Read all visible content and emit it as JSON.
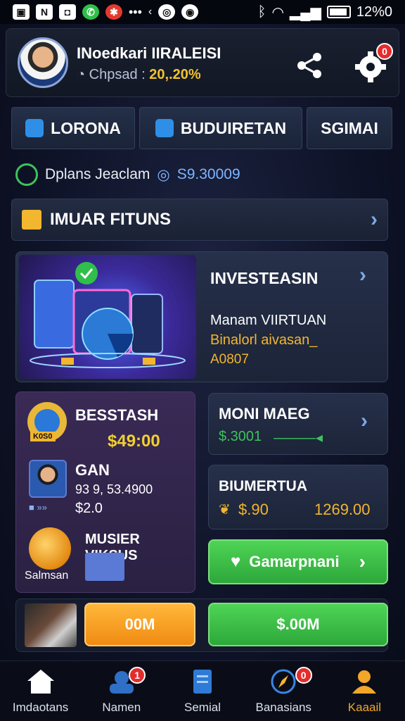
{
  "status_bar": {
    "time": "12%0"
  },
  "profile": {
    "name": "INoedkari IIRALEISI",
    "stat_label": "Chpsad :",
    "stat_value": "20,.20%",
    "settings_badge": "0"
  },
  "tabs": [
    {
      "label": "LORONA"
    },
    {
      "label": "BUDUIRETAN"
    },
    {
      "label": "SGIMAI"
    }
  ],
  "balance": {
    "label": "Dplans Jeaclam",
    "value": "S9.30009"
  },
  "banner": {
    "title": "IMUAR FITUNS"
  },
  "invest_card": {
    "title": "INVESTEASIN",
    "line1": "Manam VIIRTUAN",
    "line2": "Binalorl aivasan_",
    "line3": "A0807"
  },
  "left_panel": {
    "item1_title": "BESSTASH",
    "item1_value": "$49:00",
    "item1_medal": "K0S0",
    "item2_title": "GAN",
    "item2_line": "93 9, 53.4900",
    "item2_value": "$2.0",
    "item3_title": "MUSIER VIKSUS",
    "item3_caption": "Salmsan"
  },
  "right_cards": {
    "card1_title": "MONI MAEG",
    "card1_value": "$.3001",
    "card2_title": "BIUMERTUA",
    "card2_value_left": "$.90",
    "card2_value_right": "1269.00",
    "green_button": "Gamarpnani",
    "orange_button": "00M",
    "green_button2": "$.00M"
  },
  "nav": [
    {
      "label": "Imdaotans",
      "badge": ""
    },
    {
      "label": "Namen",
      "badge": "1"
    },
    {
      "label": "Semial",
      "badge": ""
    },
    {
      "label": "Banasians",
      "badge": "0"
    },
    {
      "label": "Kaaail",
      "badge": ""
    }
  ],
  "colors": {
    "accent": "#f2a62a",
    "green": "#3ec25b",
    "gold": "#f2b62f",
    "blue": "#2f8fe6"
  }
}
